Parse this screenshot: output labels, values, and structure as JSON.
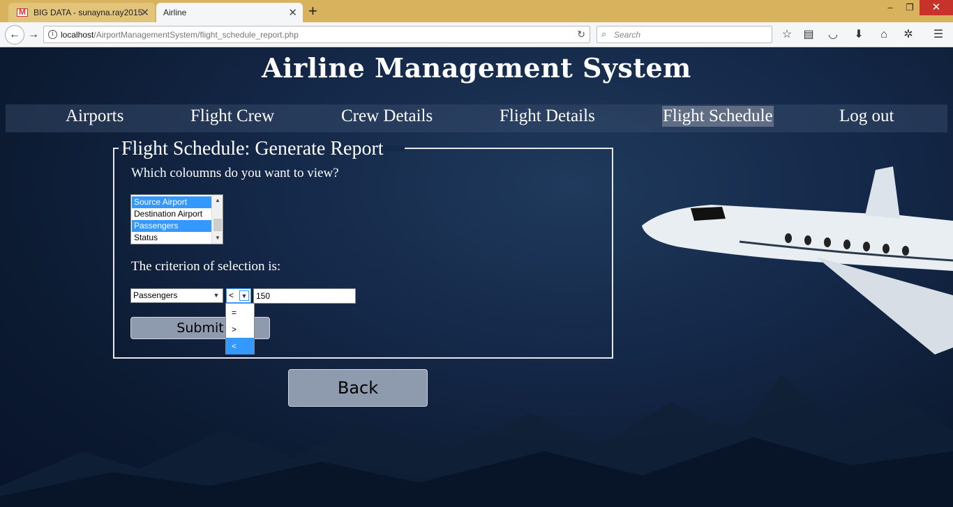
{
  "browser": {
    "tabs": [
      {
        "label": "BIG DATA - sunayna.ray2015",
        "icon": "gmail-icon",
        "active": false
      },
      {
        "label": "Airline",
        "active": true
      }
    ],
    "new_tab": "+",
    "window_controls": {
      "minimize": "–",
      "maximize": "❐",
      "close": "✕"
    },
    "url": {
      "host": "localhost",
      "path": "/AirportManagementSystem/flight_schedule_report.php"
    },
    "search_placeholder": "Search"
  },
  "site": {
    "title": "Airline Management System"
  },
  "menu": {
    "items": [
      {
        "label": "Airports",
        "active": false
      },
      {
        "label": "Flight Crew",
        "active": false
      },
      {
        "label": "Crew Details",
        "active": false
      },
      {
        "label": "Flight Details",
        "active": false
      },
      {
        "label": "Flight Schedule",
        "active": true
      },
      {
        "label": "Log out",
        "active": false
      }
    ]
  },
  "form": {
    "legend": "Flight Schedule: Generate Report",
    "columns_question": "Which coloumns do you want to view?",
    "columns_options": [
      {
        "label": "Source Airport",
        "selected": true
      },
      {
        "label": "Destination Airport",
        "selected": false
      },
      {
        "label": "Passengers",
        "selected": true
      },
      {
        "label": "Status",
        "selected": false
      }
    ],
    "criterion_label": "The criterion of selection is:",
    "criterion_column": "Passengers",
    "criterion_operator": "<",
    "criterion_value": "150",
    "operator_options": [
      "=",
      ">",
      "<"
    ],
    "operator_highlighted": "<",
    "submit_label": "Submit"
  },
  "back_label": "Back",
  "colors": {
    "selection": "#3399ff",
    "button_bg": "#8e9aae",
    "tabbar": "#d8b25c",
    "close_red": "#c7322a"
  }
}
